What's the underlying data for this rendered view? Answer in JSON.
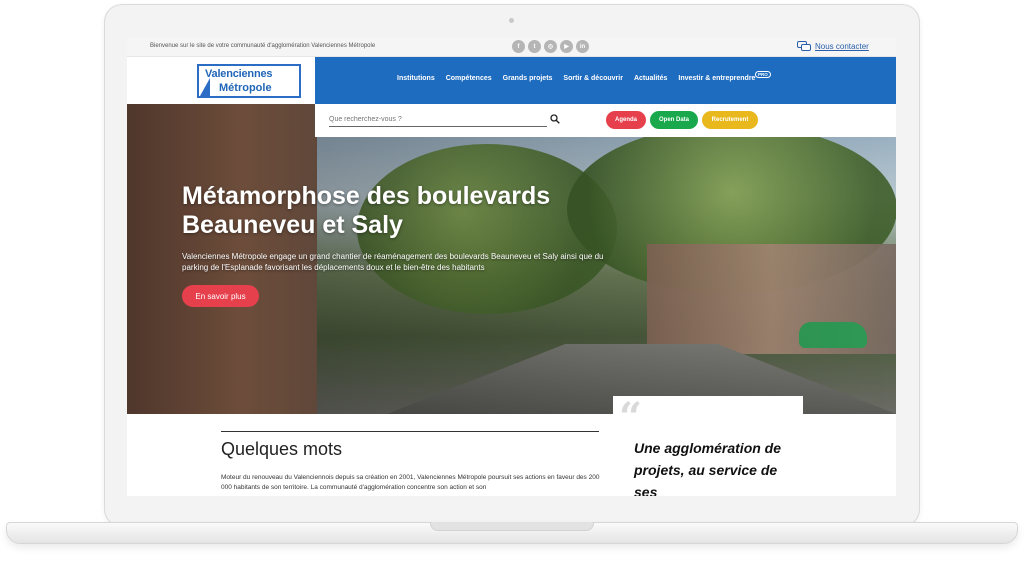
{
  "topbar": {
    "welcome": "Bienvenue sur le site de votre communauté d'agglomération Valenciennes Métropole",
    "socials": [
      {
        "icon": "facebook-icon",
        "glyph": "f"
      },
      {
        "icon": "twitter-icon",
        "glyph": "t"
      },
      {
        "icon": "instagram-icon",
        "glyph": "◎"
      },
      {
        "icon": "youtube-icon",
        "glyph": "▶"
      },
      {
        "icon": "linkedin-icon",
        "glyph": "in"
      }
    ],
    "contact_label": "Nous contacter"
  },
  "logo": {
    "line1": "Valenciennes",
    "line2": "Métropole"
  },
  "nav": {
    "items": [
      "Institutions",
      "Compétences",
      "Grands projets",
      "Sortir & découvrir",
      "Actualités",
      "Investir & entreprendre"
    ],
    "badge": "PRO"
  },
  "search": {
    "placeholder": "Que recherchez-vous ?"
  },
  "quick_links": [
    {
      "label": "Agenda",
      "color": "#e6404d"
    },
    {
      "label": "Open Data",
      "color": "#19a84b"
    },
    {
      "label": "Recrutement",
      "color": "#e8b81c"
    }
  ],
  "hero": {
    "title": "Métamorphose des boulevards Beauneveu et Saly",
    "text": "Valenciennes Métropole engage un grand chantier de réaménagement des boulevards Beauneveu et Saly ainsi que du parking de l'Esplanade favorisant les déplacements doux et le bien-être des habitants",
    "cta": "En savoir plus"
  },
  "section": {
    "title": "Quelques mots",
    "text": "Moteur du renouveau du Valenciennois depuis sa création en 2001, Valenciennes Métropole poursuit ses actions en faveur des 200 000 habitants de son territoire. La communauté d'agglomération concentre son action et son"
  },
  "quote": {
    "mark": "“",
    "text": "Une agglomération de projets, au service de ses"
  },
  "colors": {
    "nav_blue": "#1d6cc0",
    "cta_red": "#e6404d"
  }
}
